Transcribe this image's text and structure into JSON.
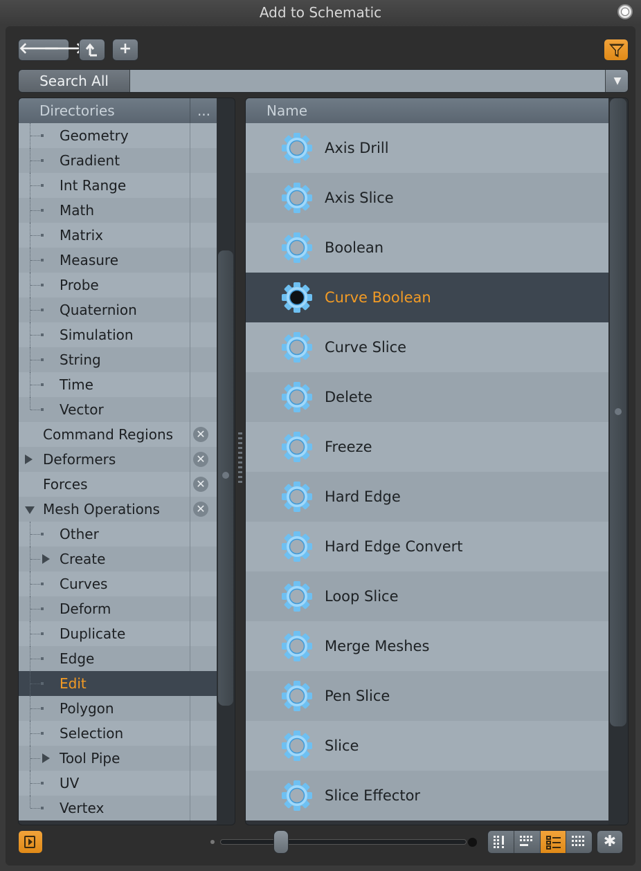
{
  "window": {
    "title": "Add to Schematic"
  },
  "toolbar": {
    "back_icon": "arrow-left-icon",
    "forward_icon": "arrow-right-icon",
    "up_icon": "up-level-icon",
    "add_icon": "plus-icon",
    "filter_icon": "filter-funnel-icon",
    "accent_color": "#f29b25"
  },
  "search": {
    "scope_label": "Search All",
    "value": "",
    "placeholder": ""
  },
  "directories": {
    "header": "Directories",
    "more_label": "...",
    "items": [
      {
        "label": "Geometry",
        "level": 1
      },
      {
        "label": "Gradient",
        "level": 1
      },
      {
        "label": "Int Range",
        "level": 1
      },
      {
        "label": "Math",
        "level": 1
      },
      {
        "label": "Matrix",
        "level": 1
      },
      {
        "label": "Measure",
        "level": 1
      },
      {
        "label": "Probe",
        "level": 1
      },
      {
        "label": "Quaternion",
        "level": 1
      },
      {
        "label": "Simulation",
        "level": 1
      },
      {
        "label": "String",
        "level": 1
      },
      {
        "label": "Time",
        "level": 1
      },
      {
        "label": "Vector",
        "level": 1
      },
      {
        "label": "Command Regions",
        "level": 0,
        "removable": true
      },
      {
        "label": "Deformers",
        "level": 0,
        "removable": true,
        "expander": "collapsed"
      },
      {
        "label": "Forces",
        "level": 0,
        "removable": true
      },
      {
        "label": "Mesh Operations",
        "level": 0,
        "removable": true,
        "expander": "expanded"
      },
      {
        "label": "Other",
        "level": 1
      },
      {
        "label": "Create",
        "level": 1,
        "expander": "collapsed"
      },
      {
        "label": "Curves",
        "level": 1
      },
      {
        "label": "Deform",
        "level": 1
      },
      {
        "label": "Duplicate",
        "level": 1
      },
      {
        "label": "Edge",
        "level": 1
      },
      {
        "label": "Edit",
        "level": 1,
        "selected": true
      },
      {
        "label": "Polygon",
        "level": 1
      },
      {
        "label": "Selection",
        "level": 1
      },
      {
        "label": "Tool Pipe",
        "level": 1,
        "expander": "collapsed"
      },
      {
        "label": "UV",
        "level": 1
      },
      {
        "label": "Vertex",
        "level": 1
      }
    ],
    "remove_glyph": "✕"
  },
  "list": {
    "header": "Name",
    "item_icon": "gear-icon",
    "items": [
      {
        "label": "Axis Drill"
      },
      {
        "label": "Axis Slice"
      },
      {
        "label": "Boolean"
      },
      {
        "label": "Curve Boolean",
        "selected": true
      },
      {
        "label": "Curve Slice"
      },
      {
        "label": "Delete"
      },
      {
        "label": "Freeze"
      },
      {
        "label": "Hard Edge"
      },
      {
        "label": "Hard Edge Convert"
      },
      {
        "label": "Loop Slice"
      },
      {
        "label": "Merge Meshes"
      },
      {
        "label": "Pen Slice"
      },
      {
        "label": "Slice"
      },
      {
        "label": "Slice Effector"
      }
    ]
  },
  "bottom_bar": {
    "panel_toggle_icon": "panel-toggle-icon",
    "icon_size_slider": 0.23,
    "view_modes": [
      {
        "icon": "small-grid-icon",
        "active": false
      },
      {
        "icon": "grid-list-icon",
        "active": false
      },
      {
        "icon": "list-view-icon",
        "active": true
      },
      {
        "icon": "large-grid-icon",
        "active": false
      }
    ],
    "settings_icon": "gear-settings-icon",
    "settings_glyph": "✱"
  }
}
